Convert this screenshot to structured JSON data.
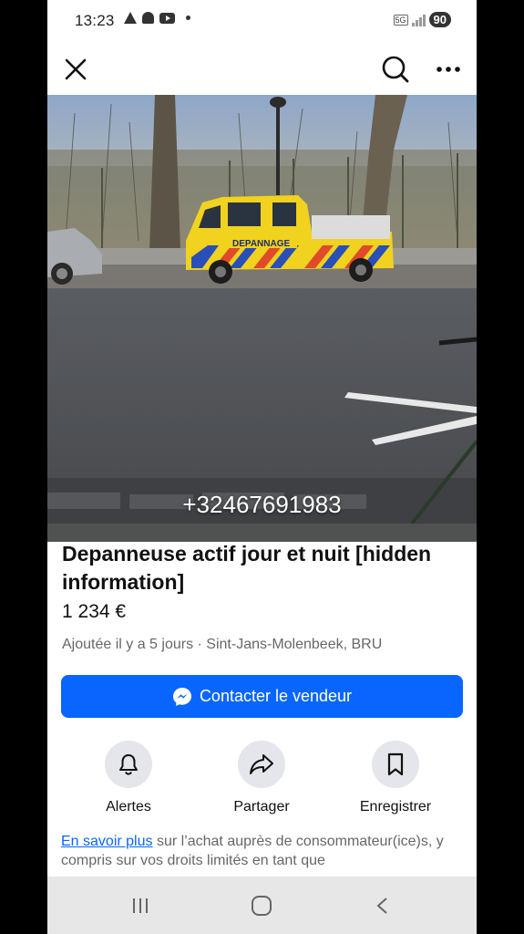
{
  "status_bar": {
    "time": "13:23",
    "network": "5G",
    "battery": "90",
    "icons": [
      "warning-icon",
      "snapchat-icon",
      "youtube-icon",
      "notification-dot-icon"
    ]
  },
  "toolbar": {
    "close_icon": "close-icon",
    "search_icon": "search-icon",
    "more_icon": "more-options-icon"
  },
  "photo": {
    "overlay_phone": "+32467691983",
    "van_text": "DEPANNAGE"
  },
  "listing": {
    "title": "Depanneuse actif jour et nuit [hidden information]",
    "price": "1 234 €",
    "meta": "Ajoutée il y a 5 jours · Sint-Jans-Molenbeek, BRU"
  },
  "contact_button": {
    "label": "Contacter le vendeur",
    "icon": "messenger-icon"
  },
  "actions": [
    {
      "label": "Alertes",
      "icon": "bell-icon"
    },
    {
      "label": "Partager",
      "icon": "share-icon"
    },
    {
      "label": "Enregistrer",
      "icon": "bookmark-icon"
    }
  ],
  "info": {
    "link_text": "En savoir plus",
    "text": " sur l’achat auprès de consommateur(ice)s, y compris sur vos droits limités en tant que"
  },
  "colors": {
    "accent": "#0866ff",
    "secondary_text": "#65676b",
    "nav_bg": "#e7e7e8"
  }
}
